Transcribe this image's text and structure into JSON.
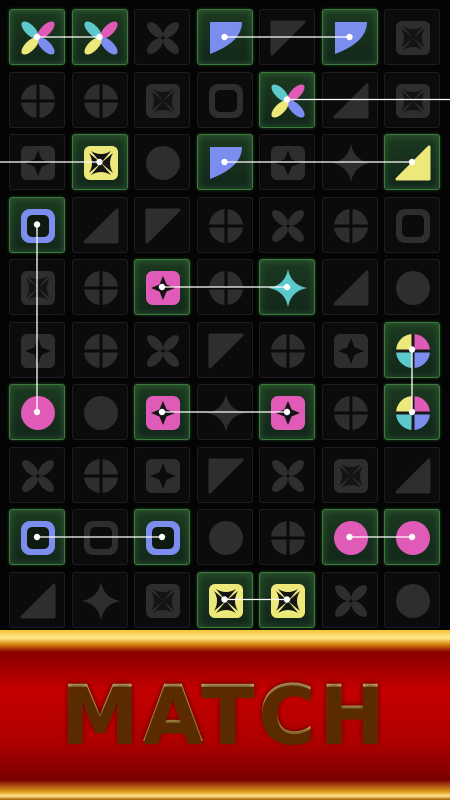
{
  "banner": {
    "text": "MATCH"
  },
  "colors": {
    "pink": "#e05ab8",
    "blue": "#7b8ef0",
    "yellow": "#ece87a",
    "teal": "#5ec9cc",
    "dim": "#2e2e2e",
    "cell_bg": "#0b0b0b",
    "highlight": "#1c3a20"
  },
  "board": {
    "rows": [
      [
        {
          "s": "pinwheel",
          "c": "multi",
          "h": true
        },
        {
          "s": "pinwheel",
          "c": "multi",
          "h": true
        },
        {
          "s": "x-petals",
          "c": "dim"
        },
        {
          "s": "quarter",
          "c": "blue",
          "h": true
        },
        {
          "s": "wedge",
          "c": "dim"
        },
        {
          "s": "quarter",
          "c": "blue",
          "h": true
        },
        {
          "s": "x-square",
          "c": "dim"
        }
      ],
      [
        {
          "s": "quad-circle",
          "c": "dim"
        },
        {
          "s": "quad-circle",
          "c": "dim"
        },
        {
          "s": "x-square",
          "c": "dim"
        },
        {
          "s": "rounded-square",
          "c": "dim"
        },
        {
          "s": "pinwheel",
          "c": "multi",
          "h": true
        },
        {
          "s": "triangle",
          "c": "dim"
        },
        {
          "s": "x-square",
          "c": "dim"
        }
      ],
      [
        {
          "s": "cross-square",
          "c": "dim"
        },
        {
          "s": "x-square",
          "c": "yellow",
          "h": true
        },
        {
          "s": "circle",
          "c": "dim"
        },
        {
          "s": "quarter",
          "c": "blue",
          "h": true
        },
        {
          "s": "cross-square",
          "c": "dim"
        },
        {
          "s": "star",
          "c": "dim"
        },
        {
          "s": "triangle",
          "c": "yellow",
          "h": true
        }
      ],
      [
        {
          "s": "rounded-square",
          "c": "blue",
          "h": true
        },
        {
          "s": "triangle",
          "c": "dim"
        },
        {
          "s": "wedge",
          "c": "dim"
        },
        {
          "s": "quad-circle",
          "c": "dim"
        },
        {
          "s": "x-petals",
          "c": "dim"
        },
        {
          "s": "quad-circle",
          "c": "dim"
        },
        {
          "s": "rounded-square",
          "c": "dim"
        }
      ],
      [
        {
          "s": "x-square",
          "c": "dim"
        },
        {
          "s": "quad-circle",
          "c": "dim"
        },
        {
          "s": "diamond-square",
          "c": "pink",
          "h": true
        },
        {
          "s": "quad-circle",
          "c": "dim"
        },
        {
          "s": "star",
          "c": "teal",
          "h": true
        },
        {
          "s": "triangle",
          "c": "dim"
        },
        {
          "s": "circle",
          "c": "dim"
        }
      ],
      [
        {
          "s": "cross-square",
          "c": "dim"
        },
        {
          "s": "quad-circle",
          "c": "dim"
        },
        {
          "s": "x-petals",
          "c": "dim"
        },
        {
          "s": "wedge",
          "c": "dim"
        },
        {
          "s": "quad-circle",
          "c": "dim"
        },
        {
          "s": "cross-square",
          "c": "dim"
        },
        {
          "s": "quad-circle",
          "c": "multi",
          "h": true
        }
      ],
      [
        {
          "s": "circle",
          "c": "pink",
          "h": true
        },
        {
          "s": "circle",
          "c": "dim"
        },
        {
          "s": "diamond-square",
          "c": "pink",
          "h": true
        },
        {
          "s": "star",
          "c": "dim"
        },
        {
          "s": "diamond-square",
          "c": "pink",
          "h": true
        },
        {
          "s": "quad-circle",
          "c": "dim"
        },
        {
          "s": "quad-circle",
          "c": "multi",
          "h": true
        }
      ],
      [
        {
          "s": "x-petals",
          "c": "dim"
        },
        {
          "s": "quad-circle",
          "c": "dim"
        },
        {
          "s": "cross-square",
          "c": "dim"
        },
        {
          "s": "wedge",
          "c": "dim"
        },
        {
          "s": "x-petals",
          "c": "dim"
        },
        {
          "s": "x-square",
          "c": "dim"
        },
        {
          "s": "triangle",
          "c": "dim"
        }
      ],
      [
        {
          "s": "rounded-square",
          "c": "blue",
          "h": true
        },
        {
          "s": "rounded-square",
          "c": "dim"
        },
        {
          "s": "rounded-square",
          "c": "blue",
          "h": true
        },
        {
          "s": "circle",
          "c": "dim"
        },
        {
          "s": "quad-circle",
          "c": "dim"
        },
        {
          "s": "circle",
          "c": "pink",
          "h": true
        },
        {
          "s": "circle",
          "c": "pink",
          "h": true
        }
      ],
      [
        {
          "s": "triangle",
          "c": "dim"
        },
        {
          "s": "star",
          "c": "dim"
        },
        {
          "s": "x-square",
          "c": "dim"
        },
        {
          "s": "x-square",
          "c": "yellow",
          "h": true
        },
        {
          "s": "x-square",
          "c": "yellow",
          "h": true
        },
        {
          "s": "x-petals",
          "c": "dim"
        },
        {
          "s": "circle",
          "c": "dim"
        }
      ]
    ],
    "links": [
      {
        "from": [
          0,
          0
        ],
        "to": [
          0,
          1
        ]
      },
      {
        "from": [
          0,
          3
        ],
        "to": [
          0,
          5
        ]
      },
      {
        "from": [
          1,
          4
        ],
        "to": [
          1,
          7
        ]
      },
      {
        "from": [
          2,
          -1
        ],
        "to": [
          2,
          1
        ]
      },
      {
        "from": [
          2,
          3
        ],
        "to": [
          2,
          6
        ]
      },
      {
        "from": [
          3,
          0
        ],
        "to": [
          6,
          0
        ]
      },
      {
        "from": [
          4,
          2
        ],
        "to": [
          4,
          4
        ]
      },
      {
        "from": [
          5,
          6
        ],
        "to": [
          6,
          6
        ]
      },
      {
        "from": [
          6,
          2
        ],
        "to": [
          6,
          4
        ]
      },
      {
        "from": [
          8,
          0
        ],
        "to": [
          8,
          2
        ]
      },
      {
        "from": [
          8,
          5
        ],
        "to": [
          8,
          6
        ]
      },
      {
        "from": [
          9,
          3
        ],
        "to": [
          9,
          4
        ]
      }
    ]
  }
}
